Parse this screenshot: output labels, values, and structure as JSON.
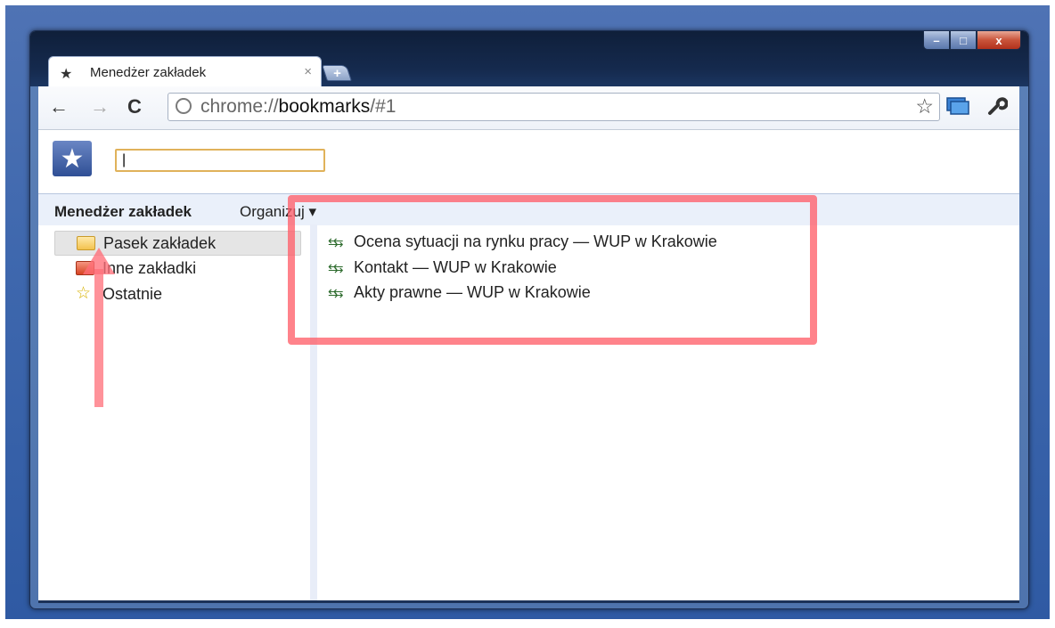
{
  "window": {
    "minimize_label": "–",
    "maximize_label": "□",
    "close_label": "x"
  },
  "tab": {
    "title": "Menedżer zakładek",
    "close_label": "×",
    "new_tab_label": "+"
  },
  "toolbar": {
    "back_icon": "←",
    "forward_icon": "→",
    "reload_icon": "C",
    "url_prefix": "chrome://",
    "url_host": "bookmarks",
    "url_suffix": "/#1",
    "star_icon": "☆"
  },
  "bookmarks": {
    "search_value": "|",
    "title": "Menedżer zakładek",
    "organize_label": "Organizuj ▾",
    "tree": [
      {
        "label": "Pasek zakładek"
      },
      {
        "label": "Inne zakładki"
      },
      {
        "label": "Ostatnie"
      }
    ],
    "items": [
      {
        "label": "Ocena sytuacji na rynku pracy — WUP w Krakowie"
      },
      {
        "label": "Kontakt — WUP w Krakowie"
      },
      {
        "label": "Akty prawne — WUP w Krakowie"
      }
    ]
  },
  "colors": {
    "annotation": "#ff5a64",
    "header_bar": "#eaf0fa",
    "selected_row": "#e5e5e5"
  }
}
